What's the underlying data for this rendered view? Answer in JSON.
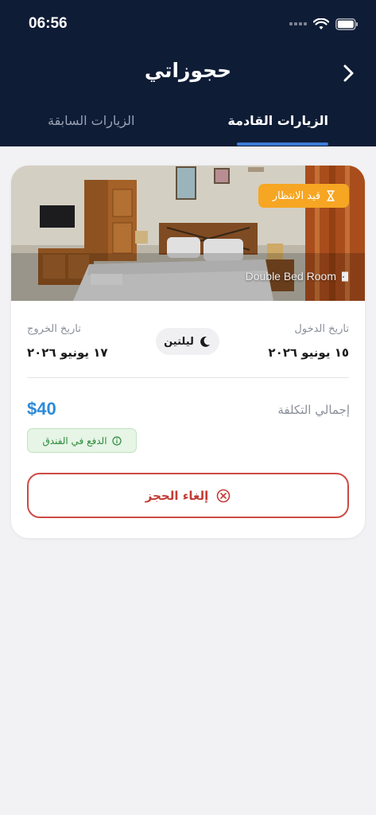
{
  "status_bar": {
    "time": "06:56"
  },
  "header": {
    "title": "حجوزاتي"
  },
  "tabs": {
    "upcoming": "الزيارات القادمة",
    "past": "الزيارات السابقة"
  },
  "booking": {
    "status": "قيد الانتظار",
    "room_name": "Double Bed Room",
    "checkin_label": "تاريخ الدخول",
    "checkin_date": "١٥ يونيو ٢٠٢٦",
    "checkout_label": "تاريخ الخروج",
    "checkout_date": "١٧ يونيو ٢٠٢٦",
    "nights": "ليلتين",
    "total_label": "إجمالي التكلفة",
    "total_price": "$40",
    "payment_note": "الدفع في الفندق",
    "cancel_label": "إلغاء الحجز"
  },
  "colors": {
    "header_bg": "#0f1c36",
    "accent": "#3a7bd5",
    "pending": "#f6a623",
    "price": "#2e8bd8",
    "danger": "#cc4b45",
    "success": "#2d8a3a"
  },
  "icons": [
    "wifi-icon",
    "battery-icon",
    "chevron-right-icon",
    "hourglass-icon",
    "door-icon",
    "moon-icon",
    "info-icon",
    "cancel-circle-icon"
  ]
}
